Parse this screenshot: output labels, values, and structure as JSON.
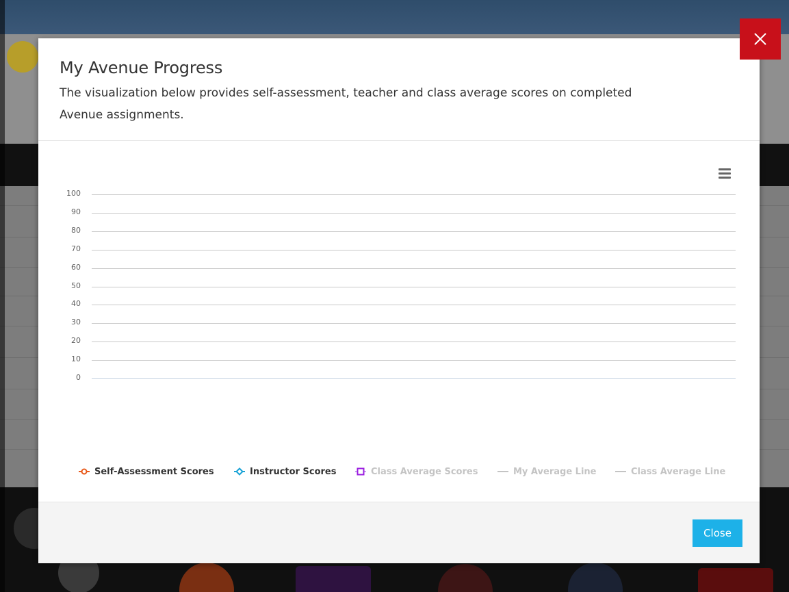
{
  "modal": {
    "title": "My Avenue Progress",
    "description": "The visualization below provides self-assessment, teacher and class average scores on completed Avenue assignments.",
    "close_label": "Close"
  },
  "icons": {
    "dismiss": "close-x-icon",
    "chart_menu": "hamburger-menu-icon"
  },
  "colors": {
    "self_assessment": "#e8591a",
    "instructor": "#1aa3d6",
    "class_average": "#9b1ee0",
    "close_button": "#1db1e8",
    "dismiss_button": "#c8101a"
  },
  "chart_data": {
    "type": "line",
    "title": "",
    "xlabel": "",
    "ylabel": "",
    "ylim": [
      0,
      100
    ],
    "y_ticks": [
      "100",
      "90",
      "80",
      "70",
      "60",
      "50",
      "40",
      "30",
      "20",
      "10",
      "0"
    ],
    "categories": [],
    "grid": true,
    "legend_position": "bottom",
    "series": [
      {
        "name": "Self-Assessment Scores",
        "values": [],
        "visible": true
      },
      {
        "name": "Instructor Scores",
        "values": [],
        "visible": true
      },
      {
        "name": "Class Average Scores",
        "values": [],
        "visible": false
      },
      {
        "name": "My Average Line",
        "values": [],
        "visible": false
      },
      {
        "name": "Class Average Line",
        "values": [],
        "visible": false
      }
    ]
  }
}
